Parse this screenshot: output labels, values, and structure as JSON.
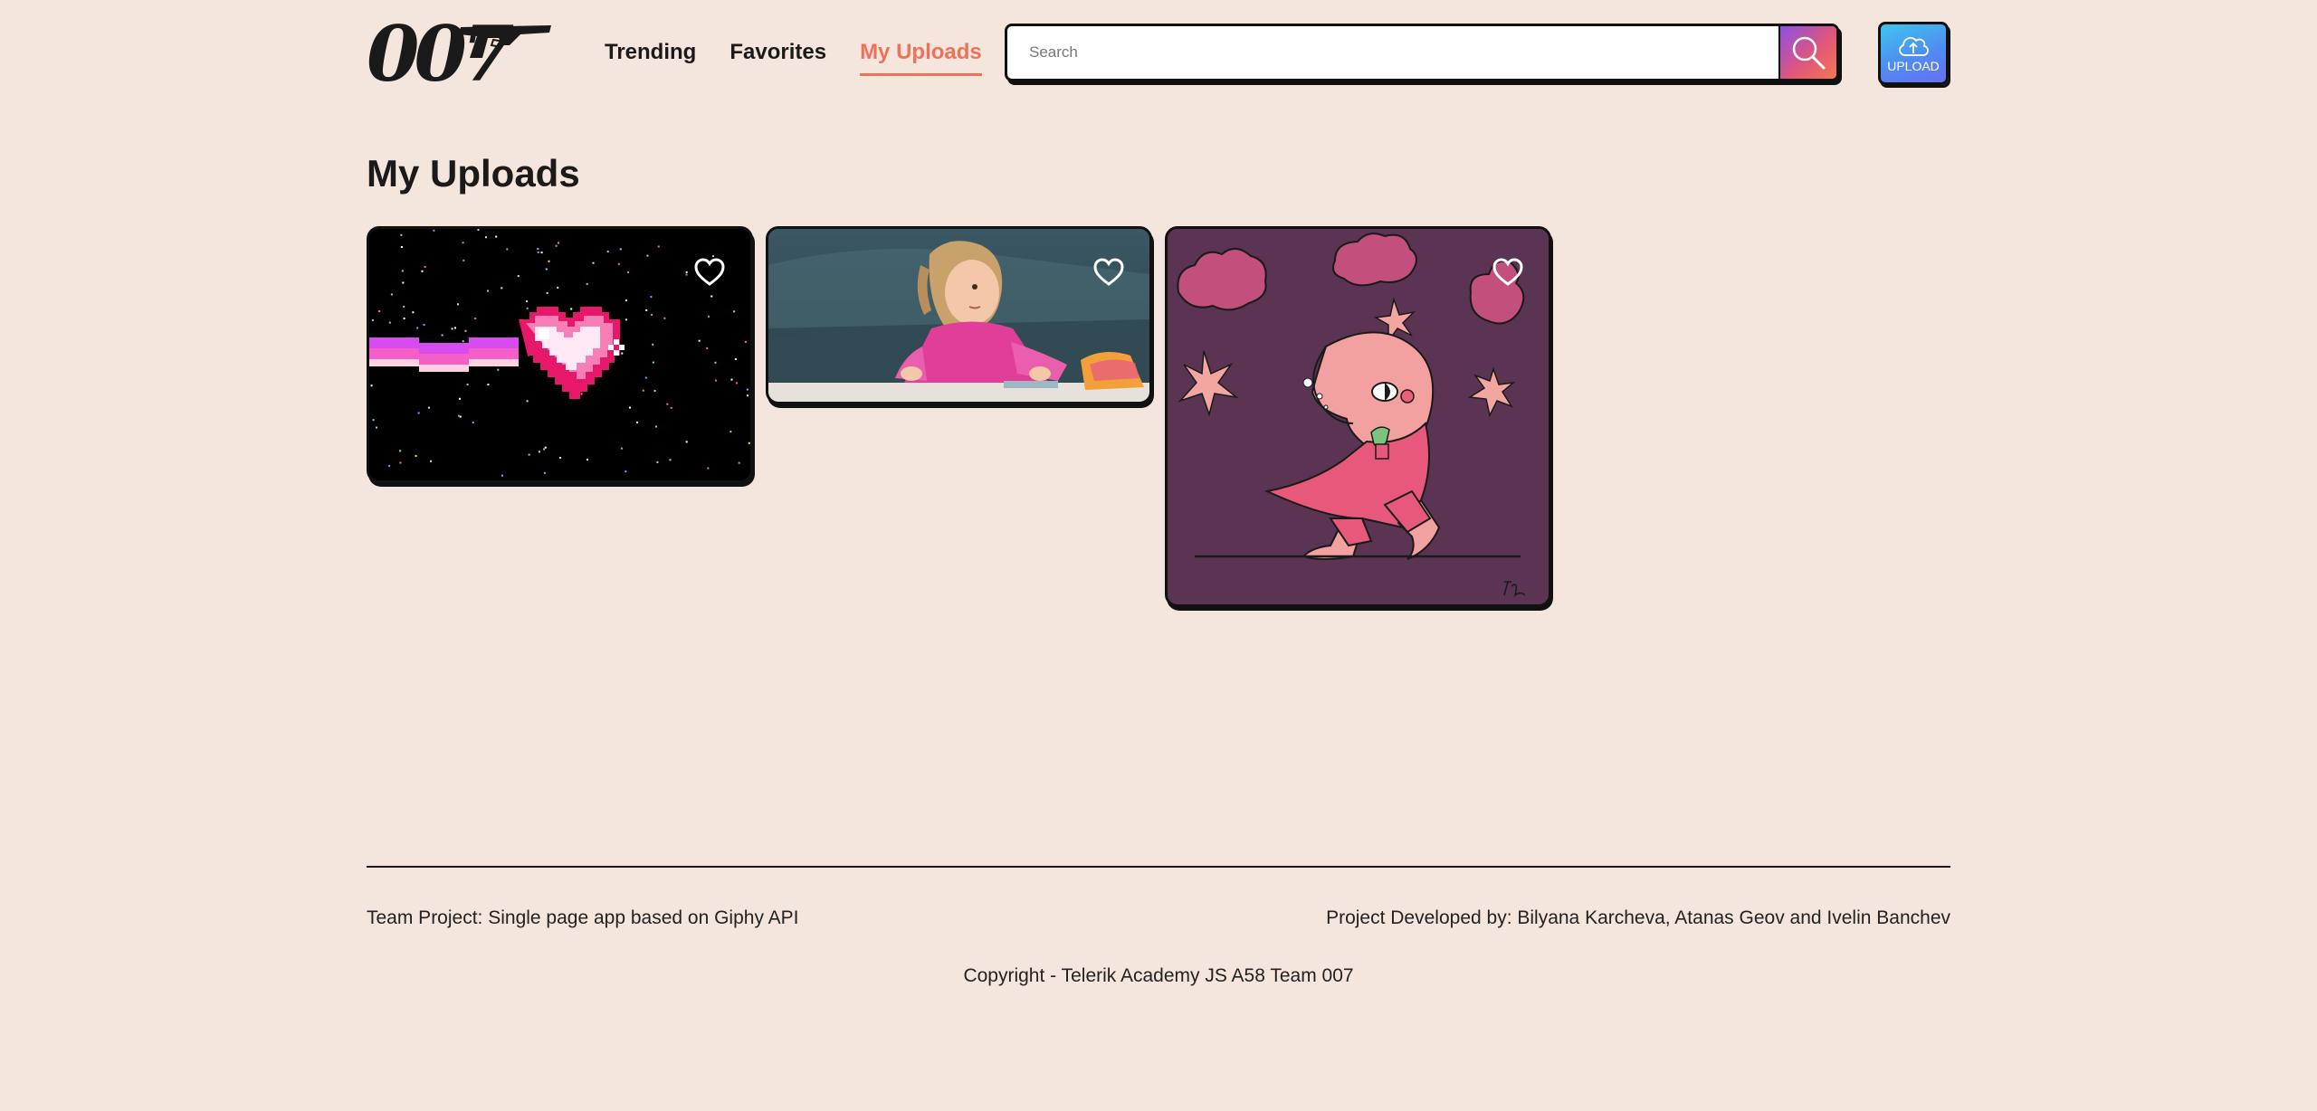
{
  "header": {
    "logo_text": "007",
    "nav": [
      {
        "label": "Trending",
        "active": false
      },
      {
        "label": "Favorites",
        "active": false
      },
      {
        "label": "My Uploads",
        "active": true
      }
    ],
    "search": {
      "placeholder": "Search",
      "value": ""
    },
    "upload_label": "UPLOAD"
  },
  "main": {
    "title": "My Uploads",
    "gifs": [
      {
        "description": "pixel heart",
        "favorited": false
      },
      {
        "description": "girl",
        "favorited": false
      },
      {
        "description": "moon character",
        "favorited": false
      }
    ]
  },
  "footer": {
    "left": "Team Project: Single page app based on Giphy API",
    "right": "Project Developed by: Bilyana Karcheva, Atanas Geov and Ivelin Banchev",
    "copyright": "Copyright - Telerik Academy JS A58 Team 007"
  },
  "colors": {
    "background": "#f5e6dd",
    "accent": "#f0715a",
    "text": "#1a1a1a"
  }
}
